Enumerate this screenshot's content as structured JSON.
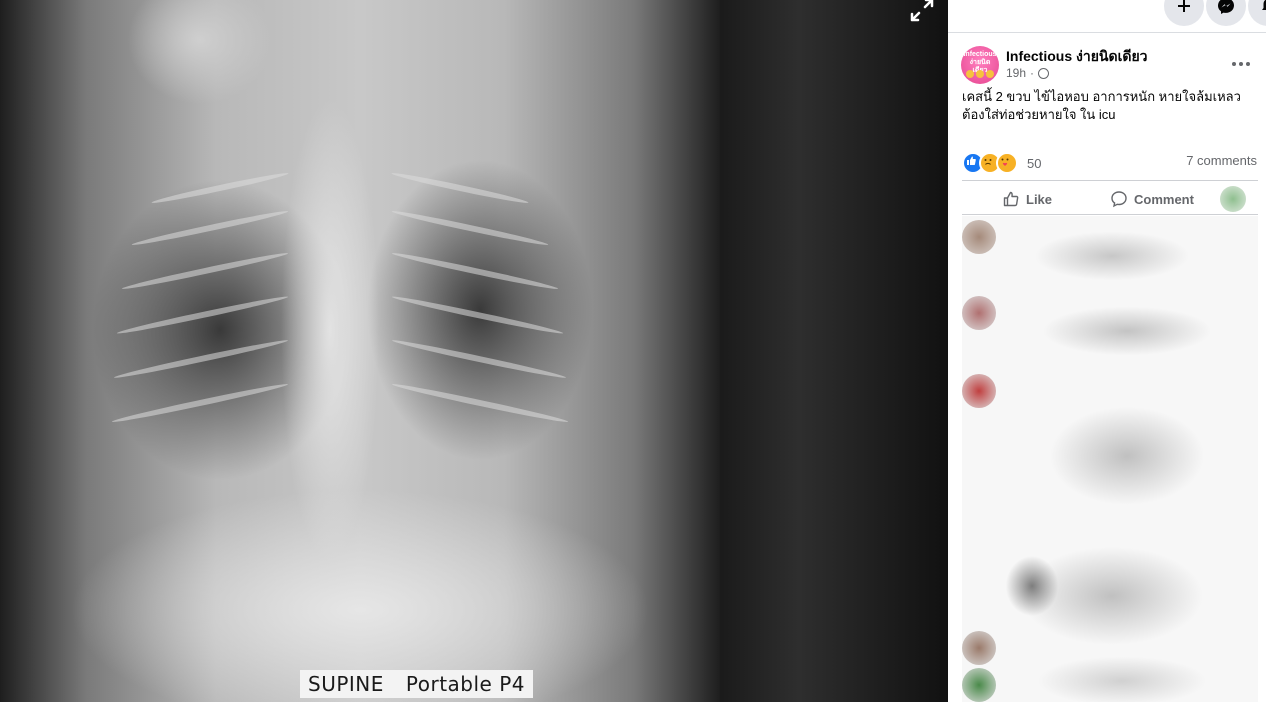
{
  "photo": {
    "label_left": "SUPINE",
    "label_right": "Portable P4"
  },
  "post": {
    "page_name": "Infectious ง่ายนิดเดียว",
    "avatar_text": "Infectious ง่ายนิดเดียว",
    "time": "19h",
    "text_line1": "เคสนี้ 2 ขวบ ไข้ไอหอบ อาการหนัก หายใจล้มเหลว",
    "text_line2": "ต้องใส่ท่อช่วยหายใจ ใน icu",
    "reaction_count": "50",
    "comments_count": "7 comments",
    "like_label": "Like",
    "comment_label": "Comment"
  },
  "colors": {
    "brand_blue": "#1877f2",
    "secondary_text": "#65676b",
    "avatar_pink": "#e5458f"
  }
}
